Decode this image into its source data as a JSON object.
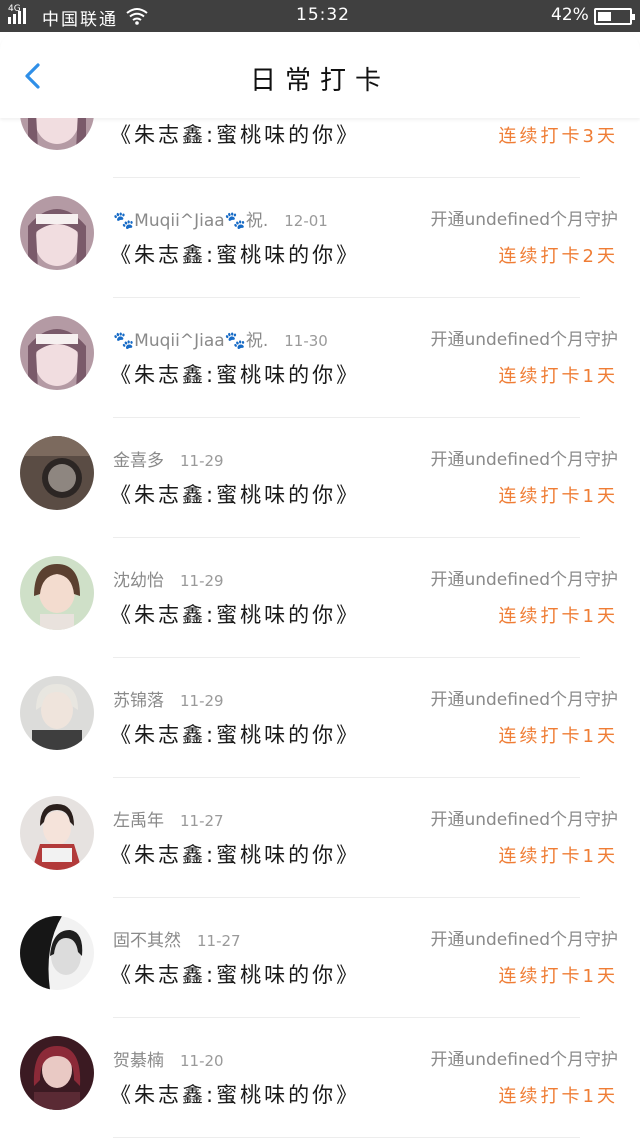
{
  "status_bar": {
    "network": "4G",
    "carrier": "中国联通",
    "time": "15:32",
    "battery": "42%",
    "battery_level": 0.42
  },
  "header": {
    "title": "日常打卡"
  },
  "colors": {
    "accent": "#ef7d35",
    "back": "#2f8fe8",
    "status_bar": "#404040"
  },
  "entries": [
    {
      "name": "",
      "date": "",
      "guard": "",
      "content": "《朱志鑫:蜜桃味的你》",
      "streak": "连续打卡3天"
    },
    {
      "name": "🐾Muqii^Jiaa🐾祝.",
      "date": "12-01",
      "guard": "开通undefined个月守护",
      "content": "《朱志鑫:蜜桃味的你》",
      "streak": "连续打卡2天"
    },
    {
      "name": "🐾Muqii^Jiaa🐾祝.",
      "date": "11-30",
      "guard": "开通undefined个月守护",
      "content": "《朱志鑫:蜜桃味的你》",
      "streak": "连续打卡1天"
    },
    {
      "name": "金喜多",
      "date": "11-29",
      "guard": "开通undefined个月守护",
      "content": "《朱志鑫:蜜桃味的你》",
      "streak": "连续打卡1天"
    },
    {
      "name": "沈幼怡",
      "date": "11-29",
      "guard": "开通undefined个月守护",
      "content": "《朱志鑫:蜜桃味的你》",
      "streak": "连续打卡1天"
    },
    {
      "name": "苏锦落",
      "date": "11-29",
      "guard": "开通undefined个月守护",
      "content": "《朱志鑫:蜜桃味的你》",
      "streak": "连续打卡1天"
    },
    {
      "name": "左禹年",
      "date": "11-27",
      "guard": "开通undefined个月守护",
      "content": "《朱志鑫:蜜桃味的你》",
      "streak": "连续打卡1天"
    },
    {
      "name": "固不其然",
      "date": "11-27",
      "guard": "开通undefined个月守护",
      "content": "《朱志鑫:蜜桃味的你》",
      "streak": "连续打卡1天"
    },
    {
      "name": "贺綦楠",
      "date": "11-20",
      "guard": "开通undefined个月守护",
      "content": "《朱志鑫:蜜桃味的你》",
      "streak": "连续打卡1天"
    }
  ]
}
